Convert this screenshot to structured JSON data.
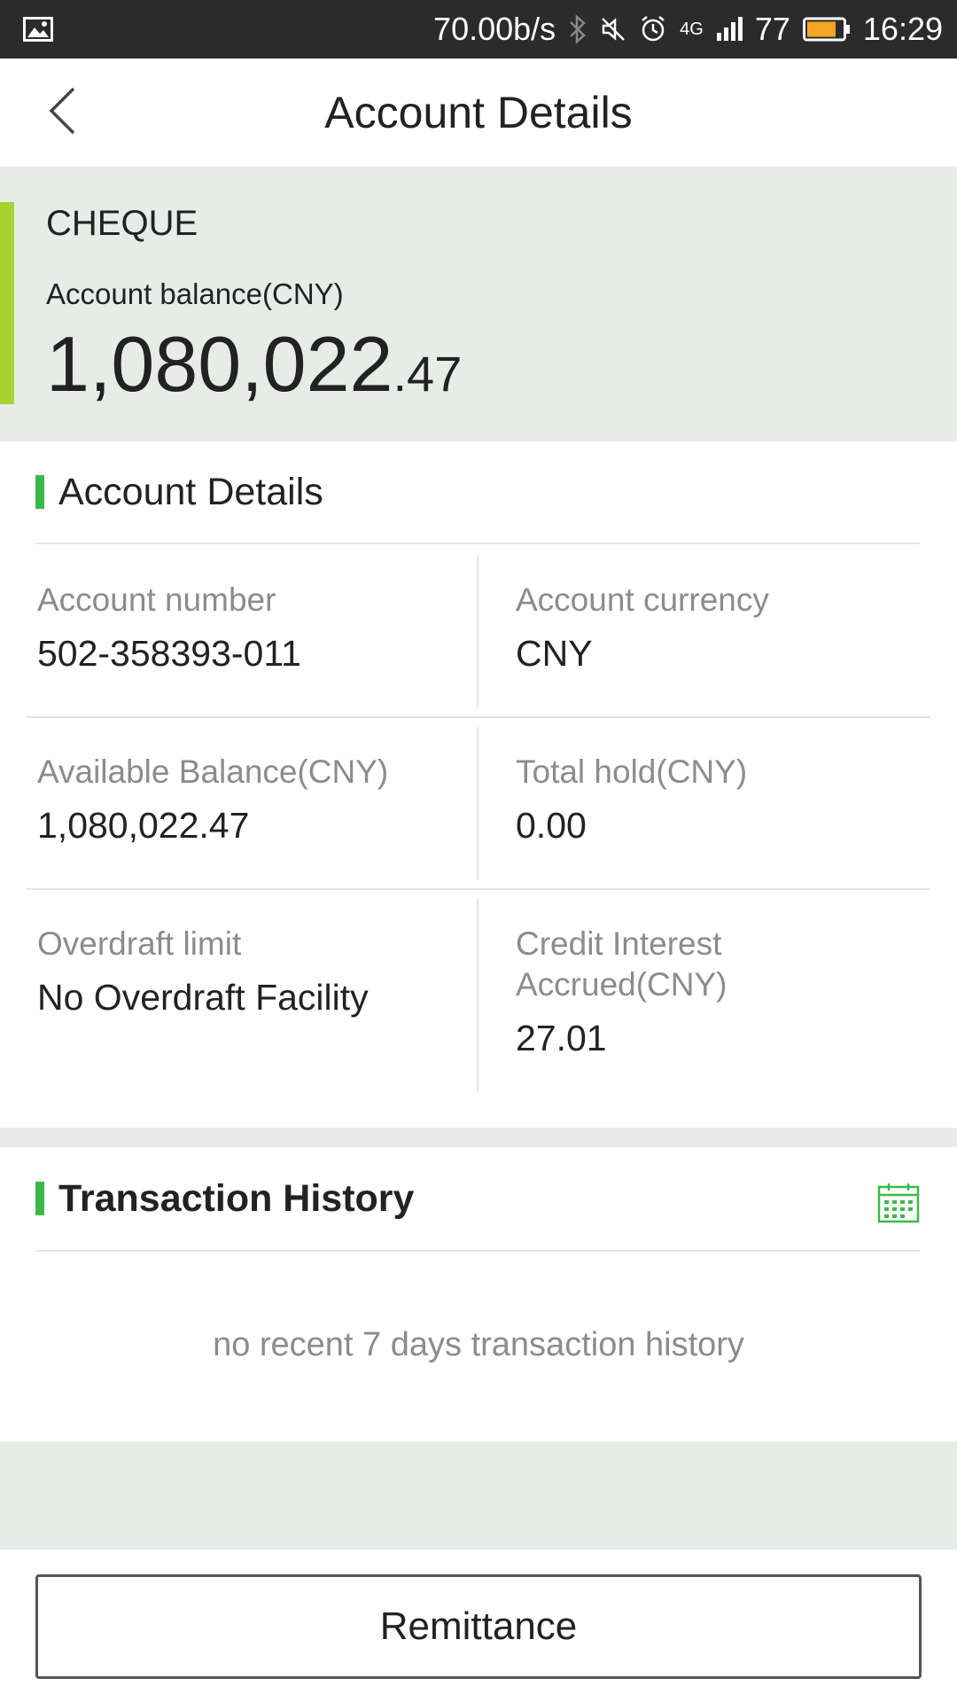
{
  "status_bar": {
    "network_speed": "70.00b/s",
    "network_type": "4G",
    "battery": "77",
    "time": "16:29",
    "icons": [
      "image-icon",
      "bluetooth-icon",
      "mute-icon",
      "alarm-icon",
      "signal-icon",
      "battery-icon"
    ]
  },
  "app_bar": {
    "title": "Account Details",
    "back_icon": "chevron-left-icon"
  },
  "balance": {
    "account_type": "CHEQUE",
    "label": "Account balance(CNY)",
    "amount_whole": "1,080,022",
    "amount_cents": ".47",
    "accent_color": "#a8d232"
  },
  "details": {
    "title": "Account Details",
    "cells": [
      {
        "label": "Account number",
        "value": "502-358393-011"
      },
      {
        "label": "Account currency",
        "value": "CNY"
      },
      {
        "label": "Available Balance(CNY)",
        "value": "1,080,022.47"
      },
      {
        "label": "Total hold(CNY)",
        "value": "0.00"
      },
      {
        "label": "Overdraft limit",
        "value": "No Overdraft Facility"
      },
      {
        "label_line1": "Credit Interest",
        "label_line2": "Accrued(CNY)",
        "value": "27.01"
      }
    ]
  },
  "history": {
    "title": "Transaction History",
    "calendar_icon": "calendar-icon",
    "empty_message": "no recent 7 days transaction history"
  },
  "actions": {
    "remittance_label": "Remittance"
  },
  "colors": {
    "section_marker": "#3cb84a",
    "status_bar": "#2b2b2b",
    "page_background": "#e8ece8",
    "battery_fill": "#f5a623"
  }
}
